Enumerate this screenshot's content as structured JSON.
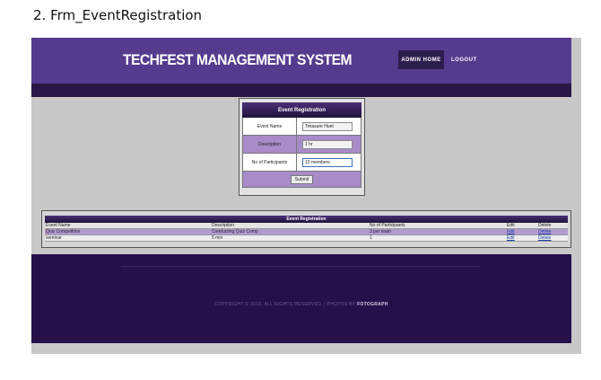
{
  "caption": "2. Frm_EventRegistration",
  "header": {
    "title": "TECHFEST MANAGEMENT SYSTEM",
    "nav": {
      "admin_home": "ADMIN HOME",
      "logout": "LOGOUT"
    }
  },
  "form": {
    "title": "Event Registration",
    "event_name_label": "Event Name",
    "event_name_value": "Treasure Hunt",
    "description_label": "Description",
    "description_value": "1 hr",
    "participants_label": "No of Participants",
    "participants_value": "10 members",
    "submit_label": "Submit"
  },
  "table": {
    "title": "Event Registration",
    "columns": [
      "Event Name",
      "Description",
      "No of Participants",
      "Edit",
      "Delete"
    ],
    "rows": [
      {
        "event_name": "Quiz Competition",
        "description": "Conducting Quiz Comp",
        "participants": "3 per team",
        "edit": "Edit",
        "delete": "Delete"
      },
      {
        "event_name": "seminar",
        "description": "5 min",
        "participants": "1",
        "edit": "Edit",
        "delete": "Delete"
      }
    ]
  },
  "footer": {
    "copyright": "COPYRIGHT © 2016. ALL RIGHTS RESERVED. | PHOTOS BY",
    "brand": "FOTOGRAPH"
  },
  "colors": {
    "header_purple": "#553b8e",
    "dark_purple": "#25104a",
    "row_purple": "#a88bc8",
    "content_gray": "#c8c8c8"
  }
}
